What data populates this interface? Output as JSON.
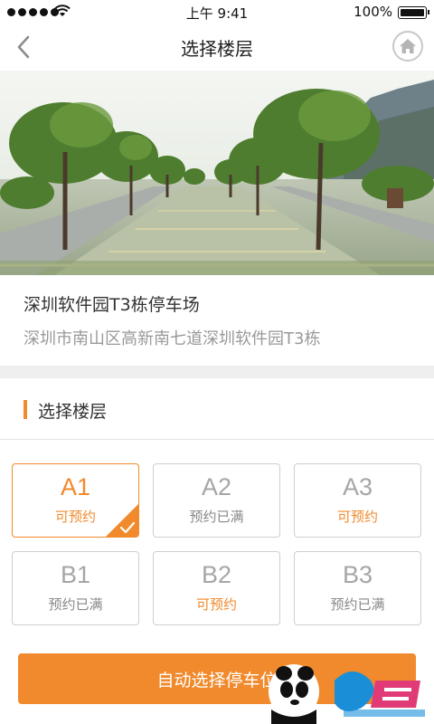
{
  "status_bar": {
    "time": "上午 9:41",
    "battery_percent": "100%"
  },
  "nav": {
    "title": "选择楼层",
    "back_icon": "chevron-left-icon",
    "home_icon": "home-icon"
  },
  "lot": {
    "name": "深圳软件园T3栋停车场",
    "address": "深圳市南山区高新南七道深圳软件园T3栋"
  },
  "section": {
    "title": "选择楼层"
  },
  "floors": [
    {
      "code": "A1",
      "status": "可预约",
      "available": true,
      "selected": true
    },
    {
      "code": "A2",
      "status": "预约已满",
      "available": false,
      "selected": false
    },
    {
      "code": "A3",
      "status": "可预约",
      "available": true,
      "selected": false
    },
    {
      "code": "B1",
      "status": "预约已满",
      "available": false,
      "selected": false
    },
    {
      "code": "B2",
      "status": "可预约",
      "available": true,
      "selected": false
    },
    {
      "code": "B3",
      "status": "预约已满",
      "available": false,
      "selected": false
    }
  ],
  "actions": {
    "auto_select_label": "自动选择停车位"
  },
  "colors": {
    "accent": "#f08a2c",
    "muted_text": "#999999"
  }
}
